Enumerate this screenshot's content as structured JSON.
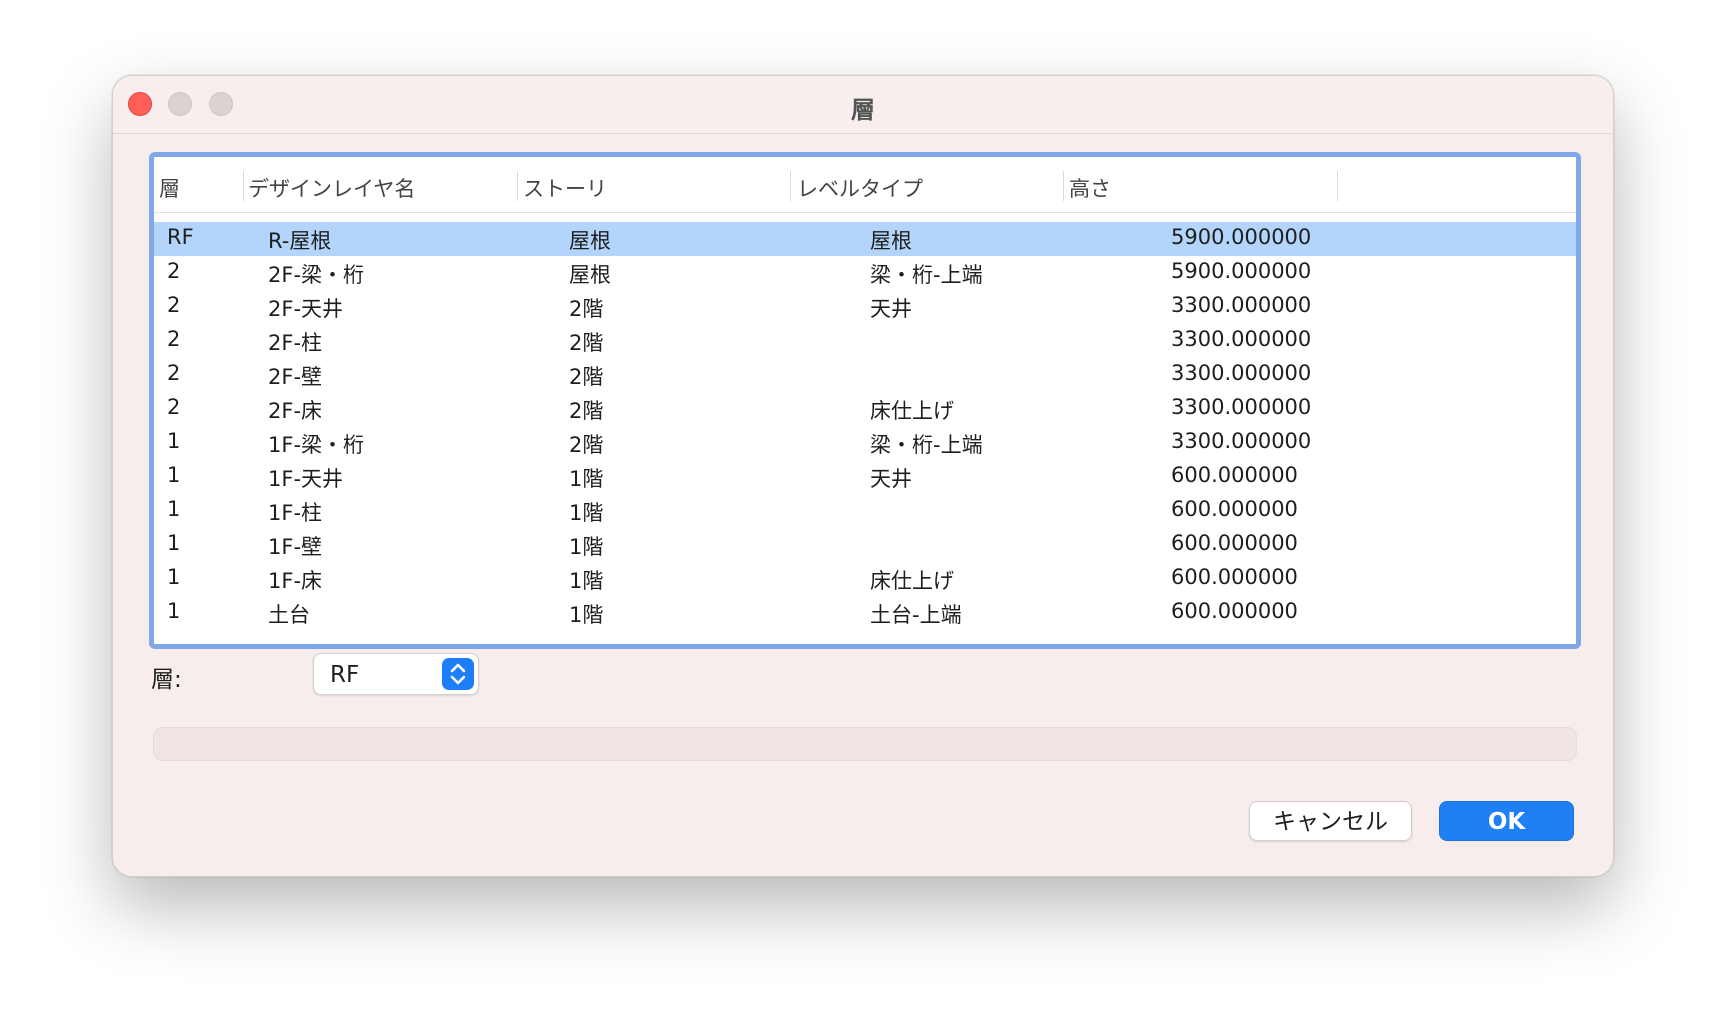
{
  "window": {
    "title": "層"
  },
  "table": {
    "columns": [
      "層",
      "デザインレイヤ名",
      "ストーリ",
      "レベルタイプ",
      "高さ"
    ],
    "rows": [
      [
        "RF",
        "R-屋根",
        "屋根",
        "屋根",
        "5900.000000"
      ],
      [
        "2",
        "2F-梁・桁",
        "屋根",
        "梁・桁-上端",
        "5900.000000"
      ],
      [
        "2",
        "2F-天井",
        "2階",
        "天井",
        "3300.000000"
      ],
      [
        "2",
        "2F-柱",
        "2階",
        "",
        "3300.000000"
      ],
      [
        "2",
        "2F-壁",
        "2階",
        "",
        "3300.000000"
      ],
      [
        "2",
        "2F-床",
        "2階",
        "床仕上げ",
        "3300.000000"
      ],
      [
        "1",
        "1F-梁・桁",
        "2階",
        "梁・桁-上端",
        "3300.000000"
      ],
      [
        "1",
        "1F-天井",
        "1階",
        "天井",
        "600.000000"
      ],
      [
        "1",
        "1F-柱",
        "1階",
        "",
        "600.000000"
      ],
      [
        "1",
        "1F-壁",
        "1階",
        "",
        "600.000000"
      ],
      [
        "1",
        "1F-床",
        "1階",
        "床仕上げ",
        "600.000000"
      ],
      [
        "1",
        "土台",
        "1階",
        "土台-上端",
        "600.000000"
      ]
    ],
    "selected_row": 0
  },
  "layer_field": {
    "label": "層:",
    "value": "RF"
  },
  "buttons": {
    "cancel": "キャンセル",
    "ok": "OK"
  },
  "colors": {
    "accent": "#1f80f6",
    "selection": "#b3d5fb",
    "focus_ring": "#7fa7ea"
  }
}
